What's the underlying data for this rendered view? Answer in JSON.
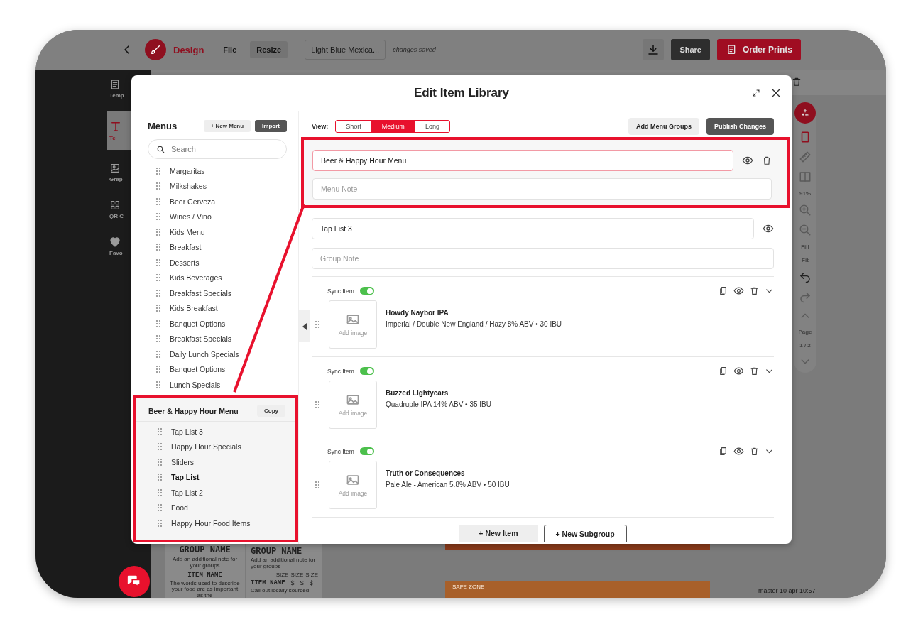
{
  "app_bar": {
    "title": "Design",
    "menu": [
      {
        "label": "File",
        "selected": false
      },
      {
        "label": "Resize",
        "selected": true
      }
    ],
    "document_name": "Light Blue Mexica...",
    "save_status": "changes saved",
    "share": "Share",
    "order": "Order Prints"
  },
  "sidebar": {
    "items": [
      {
        "label": "Temp",
        "kind": "templates",
        "selected": false
      },
      {
        "label": "Te",
        "kind": "text",
        "selected": true
      },
      {
        "label": "Grap",
        "kind": "graphics",
        "selected": false
      },
      {
        "label": "QR C",
        "kind": "qr",
        "selected": false
      },
      {
        "label": "Favo",
        "kind": "favorites",
        "selected": false
      }
    ]
  },
  "canvas": {
    "zoom": "91%",
    "fill": "Fill",
    "fit": "Fit",
    "page_label": "Page",
    "page_number": "1 / 2",
    "version": "master 10 apr 10:57",
    "safe_zone": "SAFE ZONE",
    "cards": [
      {
        "kind": "description",
        "title": "GROUP NAME",
        "note": "Add an additional note for your groups",
        "item": "ITEM NAME",
        "description": "The words used to describe your food are as important as the"
      },
      {
        "kind": "prices",
        "title": "GROUP NAME",
        "note": "Add an additional note for your groups",
        "sizes": [
          "SIZE",
          "SIZE",
          "SIZE"
        ],
        "item": "ITEM NAME",
        "prices": [
          "$",
          "$",
          "$"
        ],
        "description": "Call out locally sourced"
      }
    ]
  },
  "modal": {
    "title": "Edit Item Library",
    "menus": {
      "heading": "Menus",
      "new_button": "+ New Menu",
      "import_button": "Import",
      "search": {
        "placeholder": "Search"
      },
      "items": [
        "Margaritas",
        "Milkshakes",
        "Beer Cerveza",
        "Wines / Vino",
        "Kids Menu",
        "Breakfast",
        "Desserts",
        "Kids Beverages",
        "Breakfast Specials",
        "Kids Breakfast",
        "Banquet Options",
        "Breakfast Specials",
        "Daily Lunch Specials",
        "Banquet Options",
        "Lunch Specials"
      ],
      "open_menu": {
        "name": "Beer & Happy Hour Menu",
        "copy": "Copy",
        "groups": [
          {
            "label": "Tap List 3",
            "highlighted": false
          },
          {
            "label": "Happy Hour Specials",
            "highlighted": false
          },
          {
            "label": "Sliders",
            "highlighted": false
          },
          {
            "label": "Tap List",
            "highlighted": true
          },
          {
            "label": "Tap List 2",
            "highlighted": false
          },
          {
            "label": "Food",
            "highlighted": false
          },
          {
            "label": "Happy Hour Food Items",
            "highlighted": false
          }
        ]
      }
    },
    "editor": {
      "view_label": "View:",
      "views": [
        {
          "label": "Short",
          "selected": false
        },
        {
          "label": "Medium",
          "selected": true
        },
        {
          "label": "Long",
          "selected": false
        }
      ],
      "add_groups": "Add Menu Groups",
      "publish": "Publish Changes",
      "menu_name": "Beer & Happy Hour Menu",
      "menu_note": {
        "placeholder": "Menu Note"
      },
      "group_name": "Tap List 3",
      "group_note": {
        "placeholder": "Group Note"
      },
      "items": [
        {
          "sync_label": "Sync Item",
          "sync": true,
          "image_label": "Add image",
          "name": "Howdy Naybor IPA",
          "description": "Imperial / Double New England / Hazy 8% ABV • 30 IBU"
        },
        {
          "sync_label": "Sync Item",
          "sync": true,
          "image_label": "Add image",
          "name": "Buzzed Lightyears",
          "description": "Quadruple IPA 14% ABV • 35 IBU"
        },
        {
          "sync_label": "Sync Item",
          "sync": true,
          "image_label": "Add image",
          "name": "Truth or Consequences",
          "description": "Pale Ale - American 5.8% ABV • 50 IBU"
        }
      ],
      "new_item": "+ New Item",
      "new_subgroup": "+ New Subgroup"
    }
  }
}
